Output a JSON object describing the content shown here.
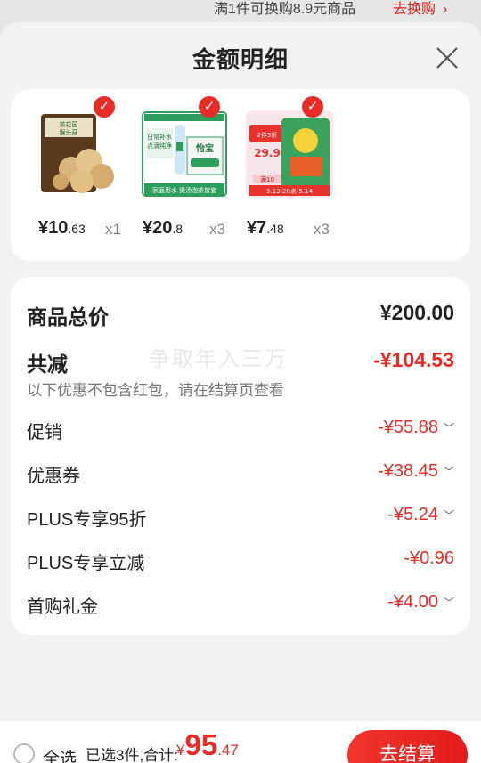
{
  "peek": {
    "text": "满1件可换购8.9元商品",
    "link": "去换购",
    "arrow": "›"
  },
  "sheet": {
    "title": "金额明细"
  },
  "products": [
    {
      "price_int": "¥10",
      "price_dec": ".63",
      "qty": "x1",
      "image": "mushroom-package-image"
    },
    {
      "price_int": "¥20",
      "price_dec": ".8",
      "qty": "x3",
      "image": "water-bottles-image"
    },
    {
      "price_int": "¥7",
      "price_dec": ".48",
      "qty": "x3",
      "image": "snack-bag-image"
    }
  ],
  "product_labels": {
    "p1_brand": "茶花园",
    "p1_name": "猴头菇",
    "p2_brand": "怡宝",
    "p2_line1": "日常补水",
    "p2_line2": "点滴纯净",
    "p2_footer": "家庭用水 煲汤泡茶皆宜",
    "p3_line1": "2件5折",
    "p3_price": "29.9",
    "p3_tag": "满10",
    "p3_date": "5.13 20点-5.14"
  },
  "amount": {
    "total_label": "商品总价",
    "total_value": "¥200.00",
    "discount_label": "共减",
    "discount_value": "-¥104.53",
    "note": "以下优惠不包含红包，请在结算页查看",
    "watermark": "争取年入三万",
    "rows": [
      {
        "label": "促销",
        "value": "-¥55.88"
      },
      {
        "label": "优惠券",
        "value": "-¥38.45"
      },
      {
        "label": "PLUS专享95折",
        "value": "-¥5.24"
      },
      {
        "label": "PLUS专享立减",
        "value": "-¥0.96"
      },
      {
        "label": "首购礼金",
        "value": "-¥4.00"
      }
    ]
  },
  "bottom": {
    "select_all": "全选",
    "summary": "已选3件,合计:",
    "total_symbol": "¥",
    "total_int": "95",
    "total_dec": ".47",
    "checkout": "去结算"
  },
  "colors": {
    "accent": "#e82b25",
    "card": "#ffffff",
    "bg": "#f2f2f2"
  },
  "icons": {
    "check": "check-circle-icon",
    "close": "close-icon",
    "chevron": "chevron-down-icon",
    "radio": "radio-unchecked-icon"
  }
}
